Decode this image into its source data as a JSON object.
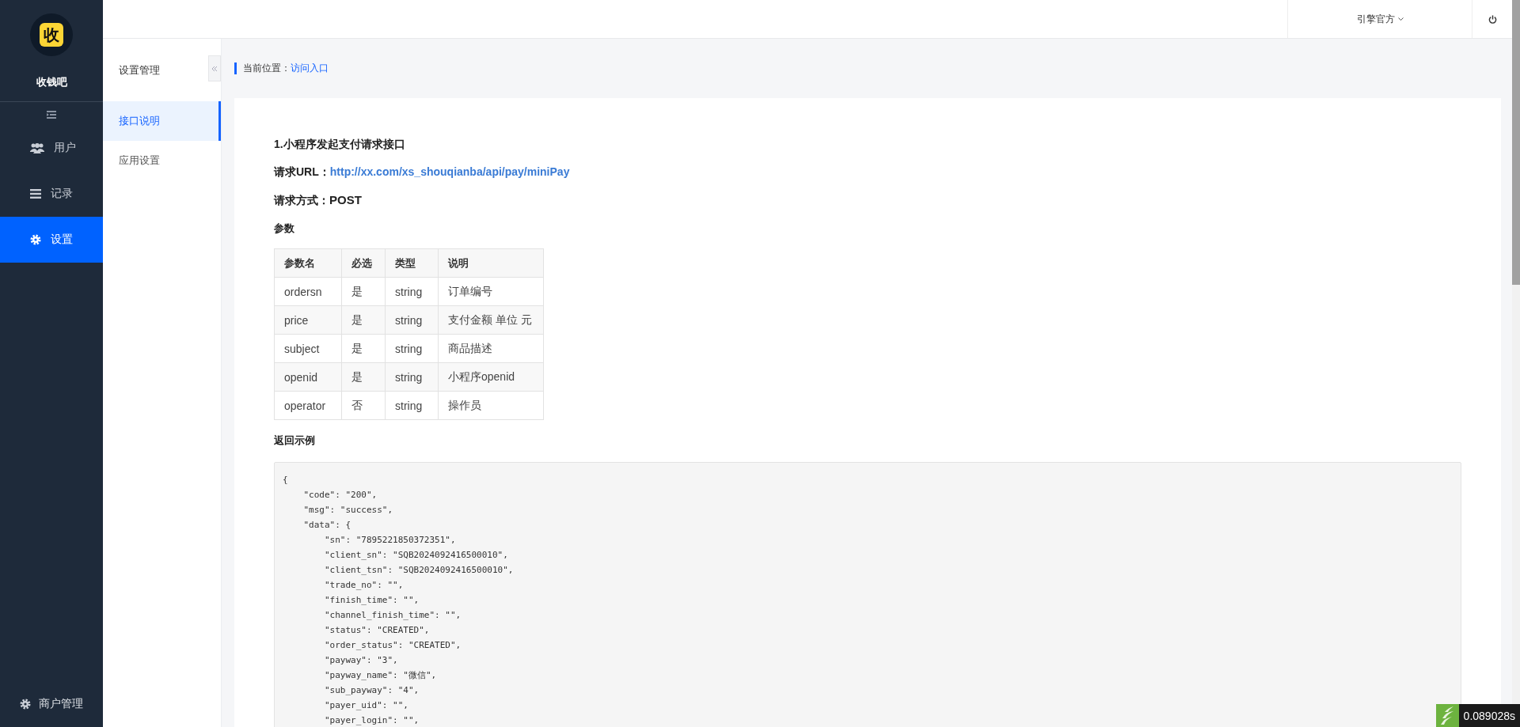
{
  "brand": {
    "name": "收钱吧",
    "logo_char": "收"
  },
  "sidebar": {
    "items": [
      {
        "label": "用户",
        "selected": false
      },
      {
        "label": "记录",
        "selected": false
      },
      {
        "label": "设置",
        "selected": true
      }
    ],
    "footer": "商户管理"
  },
  "header": {
    "user": "引擎官方"
  },
  "subnav": {
    "title": "设置管理",
    "items": [
      {
        "label": "接口说明",
        "selected": true
      },
      {
        "label": "应用设置",
        "selected": false
      }
    ]
  },
  "breadcrumb": {
    "label": "当前位置：",
    "current": "访问入口"
  },
  "doc": {
    "title": "1.小程序发起支付请求接口",
    "url_label": "请求URL：",
    "url": "http://xx.com/xs_shouqianba/api/pay/miniPay",
    "method_label": "请求方式：",
    "method": "POST",
    "params_title": "参数",
    "table": {
      "columns": [
        "参数名",
        "必选",
        "类型",
        "说明"
      ],
      "rows": [
        [
          "ordersn",
          "是",
          "string",
          "订单编号"
        ],
        [
          "price",
          "是",
          "string",
          "支付金额 单位 元"
        ],
        [
          "subject",
          "是",
          "string",
          "商品描述"
        ],
        [
          "openid",
          "是",
          "string",
          "小程序openid"
        ],
        [
          "operator",
          "否",
          "string",
          "操作员"
        ]
      ]
    },
    "example_title": "返回示例",
    "code_lines": [
      "{",
      "    \"code\": \"200\",",
      "    \"msg\": \"success\",",
      "    \"data\": {",
      "        \"sn\": \"7895221850372351\",",
      "        \"client_sn\": \"SQB2024092416500010\",",
      "        \"client_tsn\": \"SQB2024092416500010\",",
      "        \"trade_no\": \"\",",
      "        \"finish_time\": \"\",",
      "        \"channel_finish_time\": \"\",",
      "        \"status\": \"CREATED\",",
      "        \"order_status\": \"CREATED\",",
      "        \"payway\": \"3\",",
      "        \"payway_name\": \"微信\",",
      "        \"sub_payway\": \"4\",",
      "        \"payer_uid\": \"\",",
      "        \"payer_login\": \"\","
    ]
  },
  "timing": "0.089028s"
}
